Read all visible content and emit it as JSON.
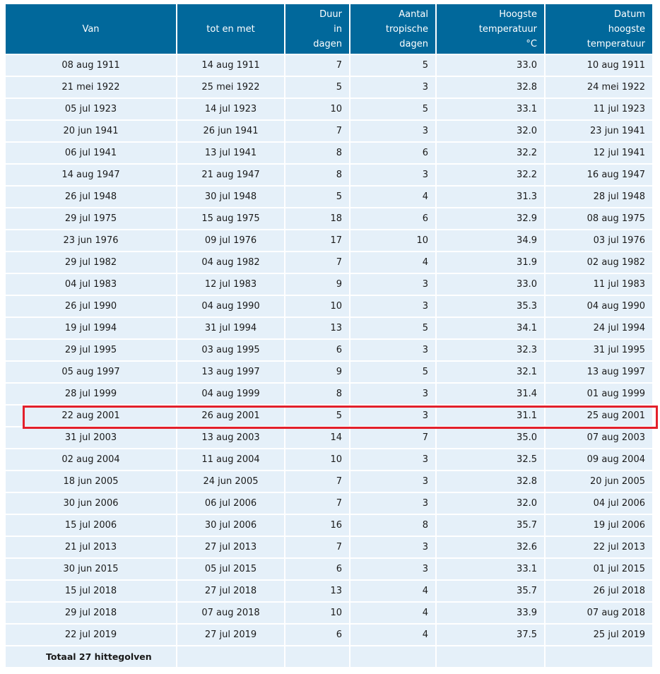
{
  "headers": {
    "van": "Van",
    "tot": "tot en met",
    "duur": [
      "Duur",
      "in",
      "dagen"
    ],
    "aantal": [
      "Aantal",
      "tropische",
      "dagen"
    ],
    "hoogste": [
      "Hoogste",
      "temperatuur",
      "°C"
    ],
    "datum": [
      "Datum",
      "hoogste",
      "temperatuur"
    ]
  },
  "rows": [
    [
      "08 aug 1911",
      "14 aug 1911",
      "7",
      "5",
      "33.0",
      "10 aug 1911"
    ],
    [
      "21 mei 1922",
      "25 mei 1922",
      "5",
      "3",
      "32.8",
      "24 mei 1922"
    ],
    [
      "05 jul 1923",
      "14 jul 1923",
      "10",
      "5",
      "33.1",
      "11 jul 1923"
    ],
    [
      "20 jun 1941",
      "26 jun 1941",
      "7",
      "3",
      "32.0",
      "23 jun 1941"
    ],
    [
      "06 jul 1941",
      "13 jul 1941",
      "8",
      "6",
      "32.2",
      "12 jul 1941"
    ],
    [
      "14 aug 1947",
      "21 aug 1947",
      "8",
      "3",
      "32.2",
      "16 aug 1947"
    ],
    [
      "26 jul 1948",
      "30 jul 1948",
      "5",
      "4",
      "31.3",
      "28 jul 1948"
    ],
    [
      "29 jul 1975",
      "15 aug 1975",
      "18",
      "6",
      "32.9",
      "08 aug 1975"
    ],
    [
      "23 jun 1976",
      "09 jul 1976",
      "17",
      "10",
      "34.9",
      "03 jul 1976"
    ],
    [
      "29 jul 1982",
      "04 aug 1982",
      "7",
      "4",
      "31.9",
      "02 aug 1982"
    ],
    [
      "04 jul 1983",
      "12 jul 1983",
      "9",
      "3",
      "33.0",
      "11 jul 1983"
    ],
    [
      "26 jul 1990",
      "04 aug 1990",
      "10",
      "3",
      "35.3",
      "04 aug 1990"
    ],
    [
      "19 jul 1994",
      "31 jul 1994",
      "13",
      "5",
      "34.1",
      "24 jul 1994"
    ],
    [
      "29 jul 1995",
      "03 aug 1995",
      "6",
      "3",
      "32.3",
      "31 jul 1995"
    ],
    [
      "05 aug 1997",
      "13 aug 1997",
      "9",
      "5",
      "32.1",
      "13 aug 1997"
    ],
    [
      "28 jul 1999",
      "04 aug 1999",
      "8",
      "3",
      "31.4",
      "01 aug 1999"
    ],
    [
      "22 aug 2001",
      "26 aug 2001",
      "5",
      "3",
      "31.1",
      "25 aug 2001"
    ],
    [
      "31 jul 2003",
      "13 aug 2003",
      "14",
      "7",
      "35.0",
      "07 aug 2003"
    ],
    [
      "02 aug 2004",
      "11 aug 2004",
      "10",
      "3",
      "32.5",
      "09 aug 2004"
    ],
    [
      "18 jun 2005",
      "24 jun 2005",
      "7",
      "3",
      "32.8",
      "20 jun 2005"
    ],
    [
      "30 jun 2006",
      "06 jul 2006",
      "7",
      "3",
      "32.0",
      "04 jul 2006"
    ],
    [
      "15 jul 2006",
      "30 jul 2006",
      "16",
      "8",
      "35.7",
      "19 jul 2006"
    ],
    [
      "21 jul 2013",
      "27 jul 2013",
      "7",
      "3",
      "32.6",
      "22 jul 2013"
    ],
    [
      "30 jun 2015",
      "05 jul 2015",
      "6",
      "3",
      "33.1",
      "01 jul 2015"
    ],
    [
      "15 jul 2018",
      "27 jul 2018",
      "13",
      "4",
      "35.7",
      "26 jul 2018"
    ],
    [
      "29 jul 2018",
      "07 aug 2018",
      "10",
      "4",
      "33.9",
      "07 aug 2018"
    ],
    [
      "22 jul 2019",
      "27 jul 2019",
      "6",
      "4",
      "37.5",
      "25 jul 2019"
    ]
  ],
  "highlighted_row": "22 aug 2001",
  "total_label": "Totaal 27 hittegolven",
  "colors": {
    "header_bg": "#01689b",
    "row_bg": "#e5f0f9",
    "highlight": "#e3202b"
  }
}
